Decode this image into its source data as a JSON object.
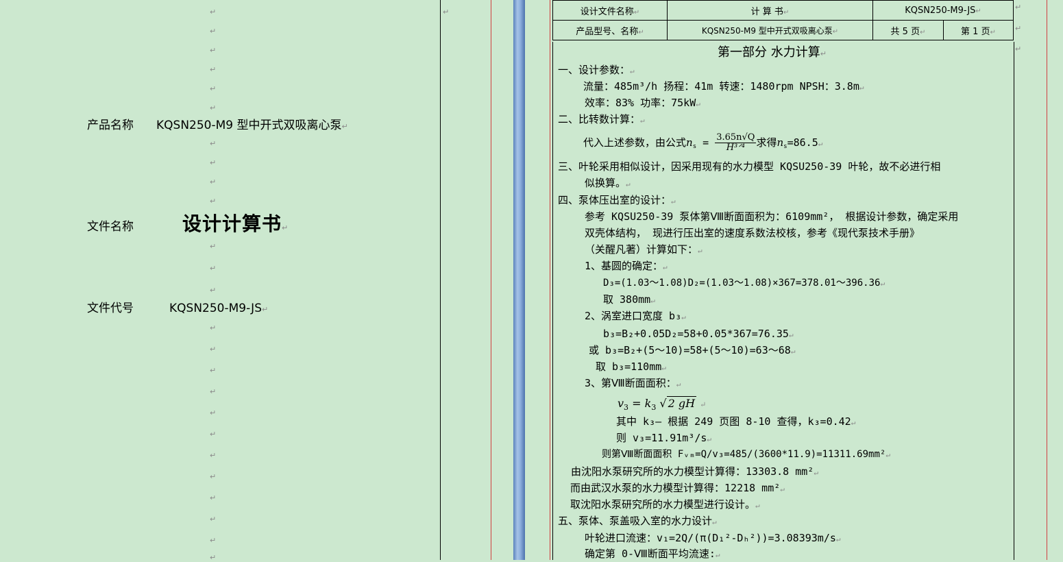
{
  "mark": "↵",
  "cover": {
    "product_label": "产品名称",
    "product_value": "KQSN250-M9 型中开式双吸离心泵",
    "file_label": "文件名称",
    "file_value": "设计计算书",
    "code_label": "文件代号",
    "code_value": "KQSN250-M9-JS"
  },
  "header": {
    "design_file_label": "设计文件名称",
    "design_file_value": "计 算 书",
    "doc_code": "KQSN250-M9-JS",
    "model_label": "产品型号、名称",
    "model_value": "KQSN250-M9 型中开式双吸离心泵",
    "total_pages": "共 5 页",
    "page_no": "第 1 页"
  },
  "body": {
    "part_title": "第一部分    水力计算",
    "l1": "一、设计参数：",
    "l2": "流量：485m³/h   扬程：41m   转速：1480rpm   NPSH：3.8m",
    "l3": "效率：83%       功率：75kW",
    "l4": "二、比转数计算：",
    "l5_pre": "代入上述参数，由公式",
    "l5_ns": "n",
    "l5_eq": " = ",
    "l5_num": "3.65n√Q",
    "l5_den": "H³ᐟ⁴",
    "l5_post": "求得",
    "l5_result": "=86.5",
    "l6": "三、叶轮采用相似设计，因采用现有的水力模型 KQSU250-39 叶轮，故不必进行相",
    "l7": "似换算。",
    "l8": "四、泵体压出室的设计：",
    "l9": "参考 KQSU250-39 泵体第Ⅷ断面面积为：6109mm²， 根据设计参数，确定采用",
    "l10": "双壳体结构， 现进行压出室的速度系数法校核，参考《现代泵技术手册》",
    "l11": "（关醒凡著）计算如下：",
    "l12": "1、基圆的确定：",
    "l13": "D₃=(1.03～1.08)D₂=(1.03～1.08)×367=378.01～396.36",
    "l14": "取 380mm",
    "l15": "2、涡室进口宽度 b₃",
    "l16": "b₃=B₂+0.05D₂=58+0.05*367=76.35",
    "l17": "或 b₃=B₂+(5～10)=58+(5～10)=63～68",
    "l18": "取 b₃=110mm",
    "l19": "3、第Ⅷ断面面积：",
    "l20_v": "v",
    "l20_eq": " = ",
    "l20_k": "k",
    "l20_sqrt": "2 gH",
    "l21": "其中 k₃— 根据 249 页图 8-10 查得，k₃=0.42",
    "l22": "则 v₃=11.91m³/s",
    "l23": "则第Ⅷ断面面积 Fᵥₘ=Q/v₃=485/(3600*11.9)=11311.69mm²",
    "l24": "由沈阳水泵研究所的水力模型计算得：13303.8 mm²",
    "l25": "而由武汉水泵的水力模型计算得：12218 mm²",
    "l26": "取沈阳水泵研究所的水力模型进行设计。",
    "l27": "五、泵体、泵盖吸入室的水力设计",
    "l28": "叶轮进口流速：v₁=2Q/(π(D₁²-Dₕ²))=3.08393m/s",
    "l29": "确定第 0-Ⅷ断面平均流速:"
  }
}
